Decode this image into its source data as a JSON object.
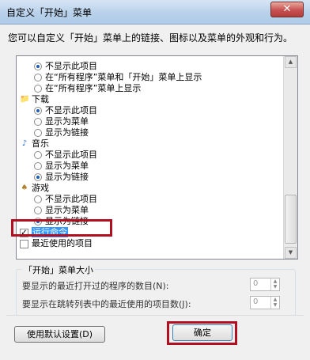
{
  "window": {
    "title": "自定义「开始」菜单",
    "close_label": "✕"
  },
  "description": "您可以自定义「开始」菜单上的链接、图标以及菜单的外观和行为。",
  "list": {
    "rows": [
      {
        "kind": "radio",
        "label": "不显示此项目",
        "selected": true,
        "indent": 1
      },
      {
        "kind": "radio",
        "label": "在“所有程序”菜单和「开始」菜单上显示",
        "selected": false,
        "indent": 1
      },
      {
        "kind": "radio",
        "label": "在“所有程序”菜单上显示",
        "selected": false,
        "indent": 1
      },
      {
        "kind": "category",
        "label": "下载",
        "icon": "download-folder-icon"
      },
      {
        "kind": "radio",
        "label": "不显示此项目",
        "selected": true,
        "indent": 1
      },
      {
        "kind": "radio",
        "label": "显示为菜单",
        "selected": false,
        "indent": 1
      },
      {
        "kind": "radio",
        "label": "显示为链接",
        "selected": false,
        "indent": 1
      },
      {
        "kind": "category",
        "label": "音乐",
        "icon": "music-note-icon"
      },
      {
        "kind": "radio",
        "label": "不显示此项目",
        "selected": false,
        "indent": 1
      },
      {
        "kind": "radio",
        "label": "显示为菜单",
        "selected": false,
        "indent": 1
      },
      {
        "kind": "radio",
        "label": "显示为链接",
        "selected": true,
        "indent": 1
      },
      {
        "kind": "category",
        "label": "游戏",
        "icon": "games-icon"
      },
      {
        "kind": "radio",
        "label": "不显示此项目",
        "selected": false,
        "indent": 1
      },
      {
        "kind": "radio",
        "label": "显示为菜单",
        "selected": false,
        "indent": 1
      },
      {
        "kind": "radio",
        "label": "显示为链接",
        "selected": true,
        "indent": 1
      },
      {
        "kind": "checkbox",
        "label": "运行命令",
        "checked": true,
        "highlighted": true,
        "indent": 0
      },
      {
        "kind": "checkbox",
        "label": "最近使用的项目",
        "checked": false,
        "indent": 0
      }
    ]
  },
  "size_group": {
    "title": "「开始」菜单大小",
    "recent_programs_label": "要显示的最近打开过的程序的数目(N):",
    "recent_programs_value": "0",
    "jumplist_label": "要显示在跳转列表中的最近使用的项目数(J):",
    "jumplist_value": "0"
  },
  "buttons": {
    "default_label": "使用默认设置(D)",
    "ok_label": "确定"
  },
  "colors": {
    "highlight": "#3399ff",
    "red_annotation": "#b01020"
  }
}
